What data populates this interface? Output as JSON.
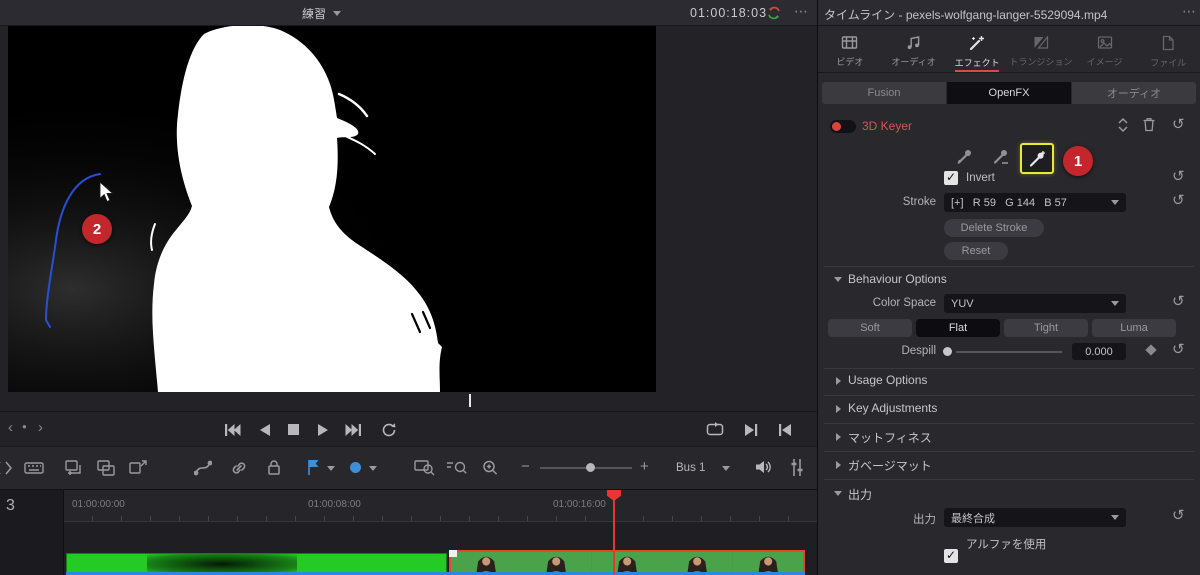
{
  "colors": {
    "accent_red": "#d84b42",
    "badge_red": "#c3272b",
    "highlight_yellow": "#e8e838",
    "clip_green": "#25cb25",
    "marker_blue": "#3f8fd8",
    "playhead_red": "#e8372e"
  },
  "glyphs": {
    "menu_dots": "⋯",
    "nav_back": "‹",
    "nav_fwd": "›",
    "nav_dot": "●",
    "minus": "−",
    "plus": "+",
    "reset": "↺"
  },
  "viewer": {
    "timeline_name": "練習",
    "timecode": "01:00:18:03",
    "annotations": {
      "step1": "1",
      "step2": "2"
    }
  },
  "inspector": {
    "title": "タイムライン - pexels-wolfgang-langer-5529094.mp4",
    "tabs": [
      {
        "label": "ビデオ"
      },
      {
        "label": "オーディオ"
      },
      {
        "label": "エフェクト"
      },
      {
        "label": "トランジション"
      },
      {
        "label": "イメージ"
      },
      {
        "label": "ファイル"
      }
    ],
    "subtabs": [
      {
        "label": "Fusion"
      },
      {
        "label": "OpenFX"
      },
      {
        "label": "オーディオ"
      }
    ],
    "effect": {
      "name": "3D Keyer",
      "invert_label": "Invert",
      "stroke_label": "Stroke",
      "stroke_value": "[+]   R 59   G 144   B 57",
      "delete_stroke_label": "Delete Stroke",
      "reset_button_label": "Reset"
    },
    "behaviour": {
      "header": "Behaviour Options",
      "color_space_label": "Color Space",
      "color_space_value": "YUV",
      "modes": [
        "Soft",
        "Flat",
        "Tight",
        "Luma"
      ],
      "selected_mode": "Flat",
      "despill_label": "Despill",
      "despill_value": "0.000"
    },
    "collapsed_sections": [
      "Usage Options",
      "Key Adjustments",
      "マットフィネス",
      "ガベージマット"
    ],
    "output": {
      "header": "出力",
      "output_label": "出力",
      "output_value": "最終合成",
      "alpha_label": "アルファを使用"
    }
  },
  "toolbar": {
    "bus_label": "Bus 1"
  },
  "timeline": {
    "track_number": "3",
    "ruler_marks": [
      "01:00:00:00",
      "01:00:08:00",
      "01:00:16:00"
    ]
  }
}
